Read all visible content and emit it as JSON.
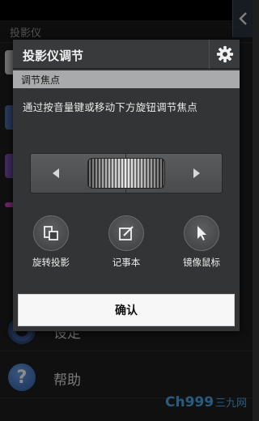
{
  "background": {
    "header_title": "投影仪",
    "rows": [
      {
        "label": "设定",
        "icon": "gear-icon"
      },
      {
        "label": "帮助",
        "icon": "help-icon"
      }
    ],
    "help_glyph": "?"
  },
  "dialog": {
    "title": "投影仪调节",
    "section_header": "调节焦点",
    "instruction": "通过按音量键或移动下方旋钮调节焦点",
    "actions": [
      {
        "label": "旋转投影",
        "icon": "rotate-projection-icon"
      },
      {
        "label": "记事本",
        "icon": "notepad-icon"
      },
      {
        "label": "镜像鼠标",
        "icon": "mouse-pointer-icon"
      }
    ],
    "confirm_label": "确认"
  },
  "colors": {
    "dialog_bg": "#333435",
    "section_header_bg": "#a9aaab",
    "confirm_bg": "#f7f7f7"
  }
}
